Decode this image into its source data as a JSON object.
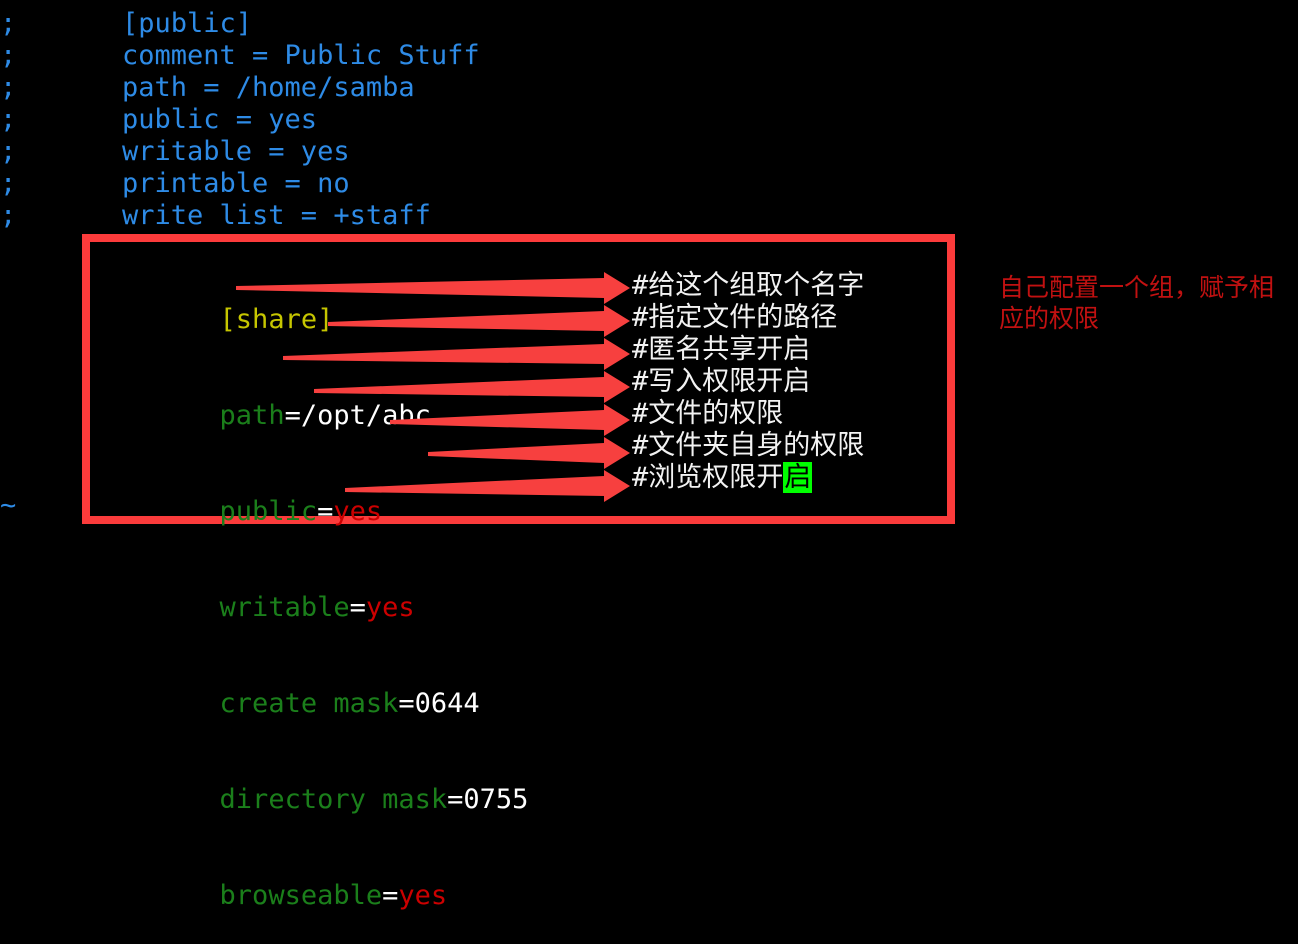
{
  "terminal": {
    "background": "#000000",
    "gutter_marks": [
      ";",
      ";",
      ";",
      ";",
      ";",
      ";",
      ";"
    ],
    "empty_line_marker": "~",
    "commented_block_color": "#2E8BE6",
    "commented_block": [
      "[public]",
      "comment = Public Stuff",
      "path = /home/samba",
      "public = yes",
      "writable = yes",
      "printable = no",
      "write list = +staff"
    ],
    "share_block": [
      {
        "section": "[share]"
      },
      {
        "key": "path",
        "eq": "=",
        "value": "/opt/abc",
        "value_color": "#FFFFFF"
      },
      {
        "key": "public",
        "eq": "=",
        "value": "yes",
        "value_color": "#CC0000"
      },
      {
        "key": "writable",
        "eq": "=",
        "value": "yes",
        "value_color": "#CC0000"
      },
      {
        "key": "create mask",
        "eq": "=",
        "value": "0644",
        "value_color": "#FFFFFF"
      },
      {
        "key": "directory mask",
        "eq": "=",
        "value": "0755",
        "value_color": "#FFFFFF"
      },
      {
        "key": "browseable",
        "eq": "=",
        "value": "yes",
        "value_color": "#CC0000"
      }
    ]
  },
  "annotations": {
    "box_color": "#FB3B3B",
    "arrow_color": "#F7403F",
    "comments": [
      {
        "hash": "#",
        "text": "给这个组取个名字"
      },
      {
        "hash": "#",
        "text": "指定文件的路径"
      },
      {
        "hash": "#",
        "text": "匿名共享开启"
      },
      {
        "hash": "#",
        "text": "写入权限开启"
      },
      {
        "hash": "#",
        "text": "文件的权限"
      },
      {
        "hash": "#",
        "text": "文件夹自身的权限"
      },
      {
        "hash": "#",
        "text": "浏览权限开",
        "cursor_char": "启"
      }
    ],
    "cursor_color": "#00FF00",
    "side_note_color": "#C11111",
    "side_note_lines": [
      "自己配置一个组，赋予相",
      "应的权限"
    ]
  }
}
